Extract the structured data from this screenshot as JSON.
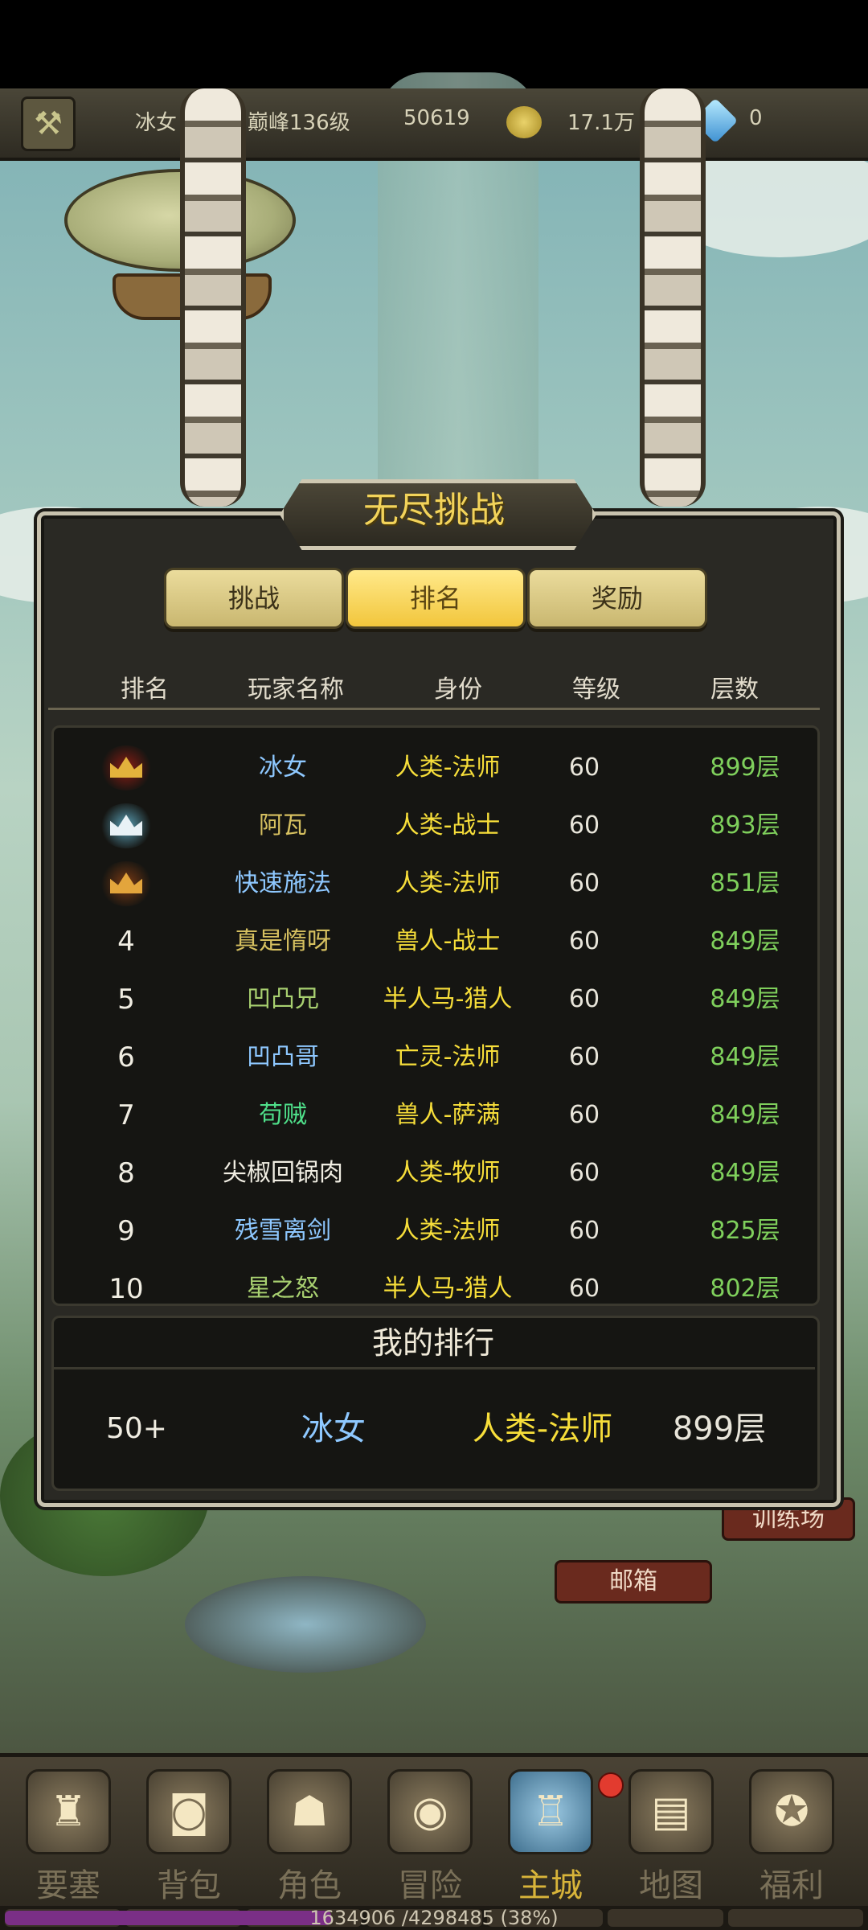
{
  "topbar": {
    "player_name": "冰女",
    "peak_level": "巅峰136级",
    "power": "50619",
    "gold": "17.1万",
    "diamonds": "0"
  },
  "panel": {
    "title": "无尽挑战",
    "tabs": [
      {
        "label": "挑战",
        "active": false
      },
      {
        "label": "排名",
        "active": true
      },
      {
        "label": "奖励",
        "active": false
      }
    ],
    "headers": [
      "排名",
      "玩家名称",
      "身份",
      "等级",
      "层数"
    ],
    "rows": [
      {
        "rank": "",
        "medal": "gold",
        "name": "冰女",
        "name_color": "#8ec8ff",
        "role": "人类-法师",
        "level": "60",
        "floor": "899层"
      },
      {
        "rank": "",
        "medal": "silver",
        "name": "阿瓦",
        "name_color": "#d6c060",
        "role": "人类-战士",
        "level": "60",
        "floor": "893层"
      },
      {
        "rank": "",
        "medal": "bronze",
        "name": "快速施法",
        "name_color": "#8ec8ff",
        "role": "人类-法师",
        "level": "60",
        "floor": "851层"
      },
      {
        "rank": "4",
        "medal": "",
        "name": "真是惰呀",
        "name_color": "#d6c060",
        "role": "兽人-战士",
        "level": "60",
        "floor": "849层"
      },
      {
        "rank": "5",
        "medal": "",
        "name": "凹凸兄",
        "name_color": "#a8d070",
        "role": "半人马-猎人",
        "level": "60",
        "floor": "849层"
      },
      {
        "rank": "6",
        "medal": "",
        "name": "凹凸哥",
        "name_color": "#8ec8ff",
        "role": "亡灵-法师",
        "level": "60",
        "floor": "849层"
      },
      {
        "rank": "7",
        "medal": "",
        "name": "苟贼",
        "name_color": "#4fe08a",
        "role": "兽人-萨满",
        "level": "60",
        "floor": "849层"
      },
      {
        "rank": "8",
        "medal": "",
        "name": "尖椒回锅肉",
        "name_color": "#f0ede2",
        "role": "人类-牧师",
        "level": "60",
        "floor": "849层"
      },
      {
        "rank": "9",
        "medal": "",
        "name": "残雪离剑",
        "name_color": "#8ec8ff",
        "role": "人类-法师",
        "level": "60",
        "floor": "825层"
      },
      {
        "rank": "10",
        "medal": "",
        "name": "星之怒",
        "name_color": "#a8d070",
        "role": "半人马-猎人",
        "level": "60",
        "floor": "802层"
      }
    ],
    "my_rank": {
      "title": "我的排行",
      "rank": "50+",
      "name": "冰女",
      "role": "人类-法师",
      "floor": "899层"
    }
  },
  "scene_signs": {
    "training": "训练场",
    "mailbox": "邮箱"
  },
  "bottom_nav": [
    {
      "label": "要塞",
      "icon": "fortress-icon",
      "glyph": "♜",
      "active": false
    },
    {
      "label": "背包",
      "icon": "backpack-icon",
      "glyph": "◙",
      "active": false
    },
    {
      "label": "角色",
      "icon": "character-icon",
      "glyph": "☗",
      "active": false
    },
    {
      "label": "冒险",
      "icon": "portal-icon",
      "glyph": "◉",
      "active": false
    },
    {
      "label": "主城",
      "icon": "castle-icon",
      "glyph": "♖",
      "active": true
    },
    {
      "label": "地图",
      "icon": "scroll-map-icon",
      "glyph": "▤",
      "active": false
    },
    {
      "label": "福利",
      "icon": "gift-bag-icon",
      "glyph": "✪",
      "active": false
    }
  ],
  "xp": {
    "text": "1634906 /4298485 (38%)",
    "fraction": 0.38
  }
}
